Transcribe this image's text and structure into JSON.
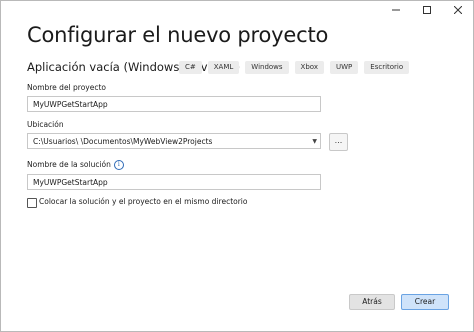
{
  "window": {
    "controls": {
      "minimize": "minimize-icon",
      "maximize": "maximize-icon",
      "close": "close-icon"
    }
  },
  "page_title": "Configurar el nuevo proyecto",
  "template": {
    "name": "Aplicación vacía (Windows universal)",
    "tags": [
      "C#",
      "XAML",
      "Windows",
      "Xbox",
      "UWP",
      "Escritorio"
    ]
  },
  "project_name": {
    "label": "Nombre del proyecto",
    "value": "MyUWPGetStartApp"
  },
  "location": {
    "label": "Ubicación",
    "value": "C:\\Usuarios\\              \\Documentos\\MyWebView2Projects",
    "browse_label": "..."
  },
  "solution_name": {
    "label": "Nombre de la solución",
    "value": "MyUWPGetStartApp",
    "info_icon": "info-icon"
  },
  "same_directory": {
    "label": "Colocar la solución y el proyecto en el mismo directorio",
    "checked": false
  },
  "footer": {
    "back_label": "Atrás",
    "create_label": "Crear"
  },
  "colors": {
    "primary_button_bg": "#cfe3fa",
    "primary_button_border": "#6aa3e3",
    "info": "#2f6ab6"
  }
}
